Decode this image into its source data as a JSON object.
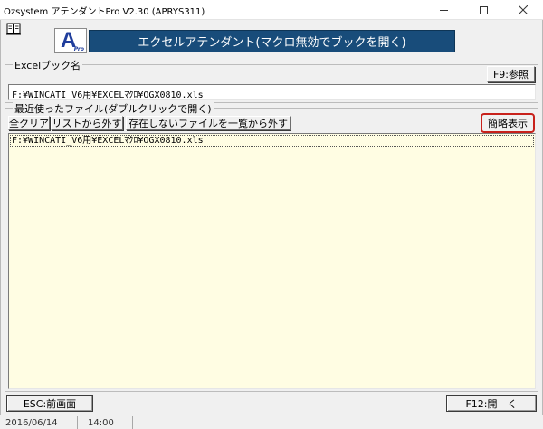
{
  "window": {
    "title": "Ozsystem アテンダントPro V2.30 (APRYS311)"
  },
  "icons": {
    "app": "book-icon",
    "minimize": "minimize-icon",
    "maximize": "maximize-icon",
    "close": "close-icon"
  },
  "logo": {
    "letter": "A",
    "sub": "Pro"
  },
  "banner": {
    "text": "エクセルアテンダント(マクロ無効でブックを開く)"
  },
  "excel_group": {
    "label": "Excelブック名",
    "ref_button": "F9:参照",
    "path_value": "F:¥WINCATI_V6用¥EXCELﾏｸﾛ¥OGX0810.xls"
  },
  "recent_group": {
    "label": "最近使ったファイル(ダブルクリックで開く)",
    "buttons": {
      "clear_all": "全クリア",
      "remove_from_list": "リストから外す",
      "remove_missing": "存在しないファイルを一覧から外す",
      "brief_view": "簡略表示"
    },
    "items": [
      "F:¥WINCATI_V6用¥EXCELﾏｸﾛ¥OGX0810.xls"
    ]
  },
  "footer": {
    "esc_button": "ESC:前画面",
    "open_button": "F12:開　く"
  },
  "status": {
    "date": "2016/06/14",
    "time": "14:00"
  },
  "colors": {
    "banner_bg": "#184c7a",
    "list_bg": "#fffde3",
    "highlight_border": "#c8211b",
    "logo_blue": "#1f3d9c"
  }
}
